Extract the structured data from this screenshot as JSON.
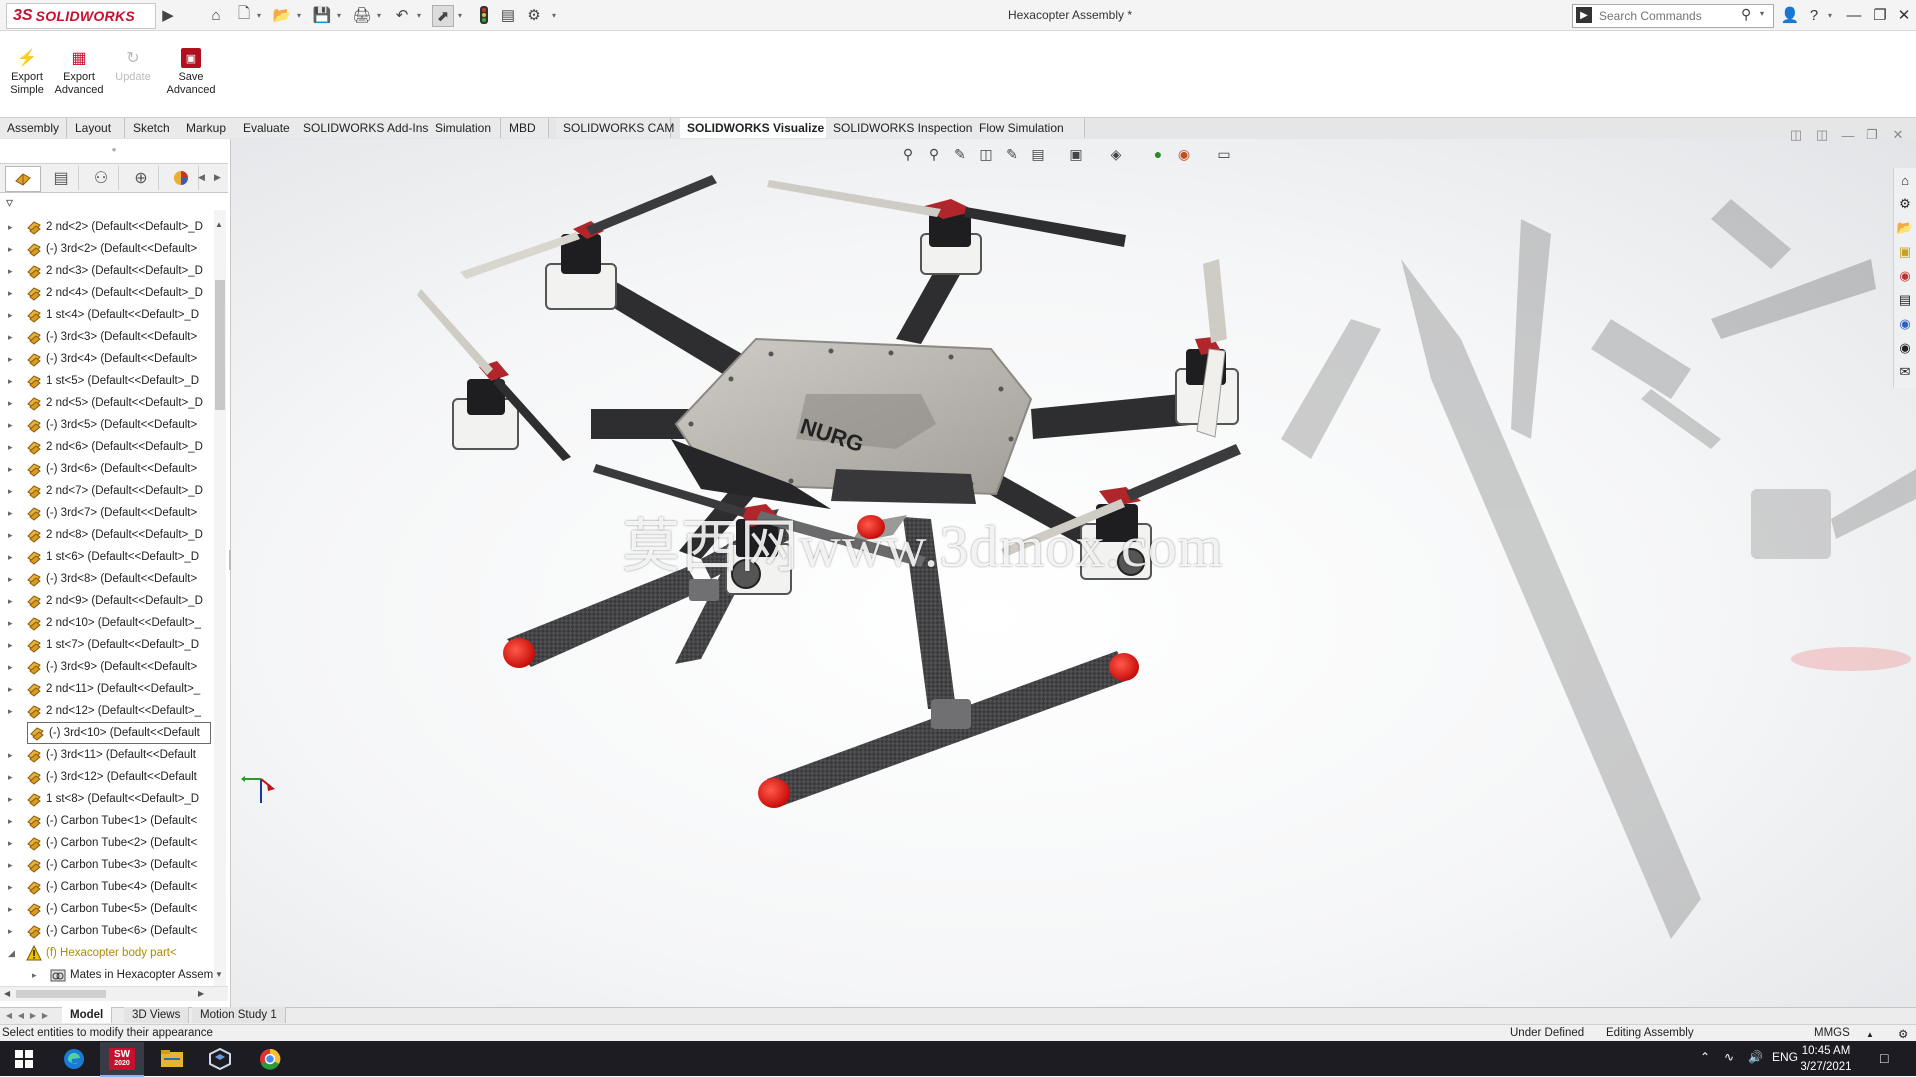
{
  "app": {
    "logo_ds": "3S",
    "logo_name": "SOLIDWORKS",
    "window_title": "Hexacopter Assembly *",
    "search_placeholder": "Search Commands"
  },
  "title_toolbar": [
    "home-icon",
    "new-file-icon",
    "open-folder-icon",
    "save-icon",
    "print-icon",
    "undo-icon",
    "select-arrow-icon",
    "traffic-light-icon",
    "file-properties-icon",
    "options-gear-icon"
  ],
  "command_buttons": [
    {
      "label": "Export\nSimple",
      "icon": "lightning-icon",
      "enabled": true
    },
    {
      "label": "Export\nAdvanced",
      "icon": "export-advanced-icon",
      "enabled": true
    },
    {
      "label": "Update",
      "icon": "update-icon",
      "enabled": false
    },
    {
      "label": "Save\nAdvanced",
      "icon": "save-advanced-icon",
      "enabled": true
    }
  ],
  "command_tabs": [
    "Assembly",
    "Layout",
    "Sketch",
    "Markup",
    "Evaluate",
    "SOLIDWORKS Add-Ins",
    "Simulation",
    "MBD",
    "SOLIDWORKS CAM",
    "SOLIDWORKS Visualize",
    "SOLIDWORKS Inspection",
    "Flow Simulation"
  ],
  "active_command_tab": "SOLIDWORKS Visualize",
  "feature_manager": {
    "tabs": [
      "featuremanager-tree-icon",
      "propertymanager-icon",
      "configurationmanager-icon",
      "dimxpert-icon",
      "display-manager-icon"
    ],
    "items": [
      {
        "label": "2 nd<2> (Default<<Default>_D"
      },
      {
        "label": "(-) 3rd<2> (Default<<Default>"
      },
      {
        "label": "2 nd<3> (Default<<Default>_D"
      },
      {
        "label": "2 nd<4> (Default<<Default>_D"
      },
      {
        "label": "1 st<4> (Default<<Default>_D"
      },
      {
        "label": "(-) 3rd<3> (Default<<Default>"
      },
      {
        "label": "(-) 3rd<4> (Default<<Default>"
      },
      {
        "label": "1 st<5> (Default<<Default>_D"
      },
      {
        "label": "2 nd<5> (Default<<Default>_D"
      },
      {
        "label": "(-) 3rd<5> (Default<<Default>"
      },
      {
        "label": "2 nd<6> (Default<<Default>_D"
      },
      {
        "label": "(-) 3rd<6> (Default<<Default>"
      },
      {
        "label": "2 nd<7> (Default<<Default>_D"
      },
      {
        "label": "(-) 3rd<7> (Default<<Default>"
      },
      {
        "label": "2 nd<8> (Default<<Default>_D"
      },
      {
        "label": "1 st<6> (Default<<Default>_D"
      },
      {
        "label": "(-) 3rd<8> (Default<<Default>"
      },
      {
        "label": "2 nd<9> (Default<<Default>_D"
      },
      {
        "label": "2 nd<10> (Default<<Default>_"
      },
      {
        "label": "1 st<7> (Default<<Default>_D"
      },
      {
        "label": "(-) 3rd<9> (Default<<Default>"
      },
      {
        "label": "2 nd<11> (Default<<Default>_"
      },
      {
        "label": "2 nd<12> (Default<<Default>_"
      },
      {
        "label": "(-) 3rd<10> (Default<<Default"
      },
      {
        "label": "(-) 3rd<11> (Default<<Default"
      },
      {
        "label": "(-) 3rd<12> (Default<<Default"
      },
      {
        "label": "1 st<8> (Default<<Default>_D"
      },
      {
        "label": "(-) Carbon Tube<1> (Default<"
      },
      {
        "label": "(-) Carbon Tube<2> (Default<"
      },
      {
        "label": "(-) Carbon Tube<3> (Default<"
      },
      {
        "label": "(-) Carbon Tube<4> (Default<"
      },
      {
        "label": "(-) Carbon Tube<5> (Default<"
      },
      {
        "label": "(-) Carbon Tube<6> (Default<"
      },
      {
        "label": "(f) Hexacopter body part<"
      },
      {
        "label": "Mates in Hexacopter Assem"
      }
    ],
    "selected_index": 23,
    "warning_index": 33,
    "mates_index": 34
  },
  "viewport": {
    "heads_up_toolbar": [
      "zoom-to-fit-icon",
      "zoom-to-area-icon",
      "previous-view-icon",
      "section-view-icon",
      "dynamic-annotation-icon",
      "view-orientation-icon",
      "display-style-icon",
      "hide-show-icon",
      "edit-appearance-icon",
      "apply-scene-icon",
      "view-settings-icon"
    ],
    "watermark": "莫西网www.3dmox.com",
    "plate_text": "NURG",
    "task_pane": [
      "home-icon",
      "resources-icon",
      "design-library-icon",
      "file-explorer-icon",
      "view-palette-icon",
      "appearances-icon",
      "custom-properties-icon",
      "solidworks-forum-icon",
      "chat-icon"
    ]
  },
  "bottom_tabs": [
    "Model",
    "3D Views",
    "Motion Study 1"
  ],
  "active_bottom_tab": "Model",
  "status": {
    "message": "Select entities to modify their appearance",
    "definition": "Under Defined",
    "mode": "Editing Assembly",
    "units": "MMGS"
  },
  "taskbar": {
    "apps": [
      "windows-start-icon",
      "edge-icon",
      "solidworks-2020-icon",
      "file-explorer-icon",
      "solidworks-visualize-icon",
      "chrome-icon"
    ],
    "sw_badge": "2020",
    "language": "ENG",
    "time": "10:45 AM",
    "date": "3/27/2021"
  },
  "colors": {
    "brand_red": "#c8102e",
    "rotor_cap_red": "#e01010",
    "carbon": "#3c3c3e",
    "plate": "#b9b6b0"
  }
}
